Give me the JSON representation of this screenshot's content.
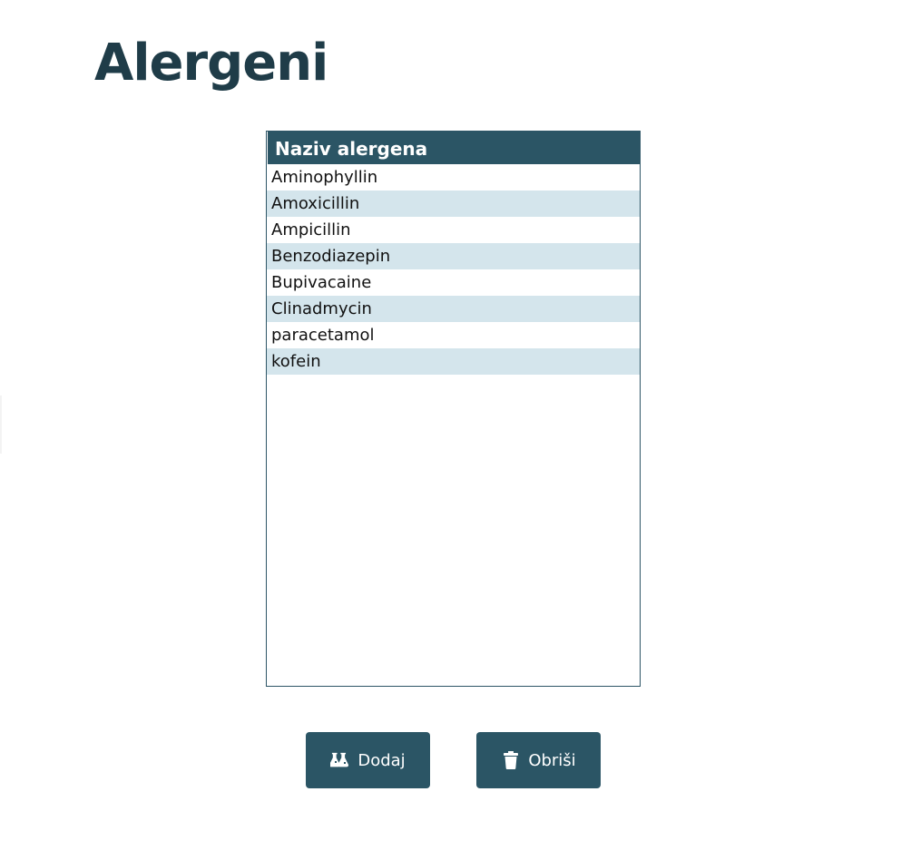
{
  "page": {
    "title": "Alergeni"
  },
  "table": {
    "header": "Naziv alergena",
    "rows": [
      "Aminophyllin",
      "Amoxicillin",
      "Ampicillin",
      "Benzodiazepin",
      "Bupivacaine",
      "Clinadmycin",
      "paracetamol",
      "kofein"
    ]
  },
  "buttons": {
    "add": {
      "label": "Dodaj",
      "icon": "flask-icon"
    },
    "delete": {
      "label": "Obriši",
      "icon": "trash-icon"
    }
  },
  "colors": {
    "primary": "#2b5565",
    "title": "#1f3c48",
    "row_alt": "#d4e5ec"
  }
}
